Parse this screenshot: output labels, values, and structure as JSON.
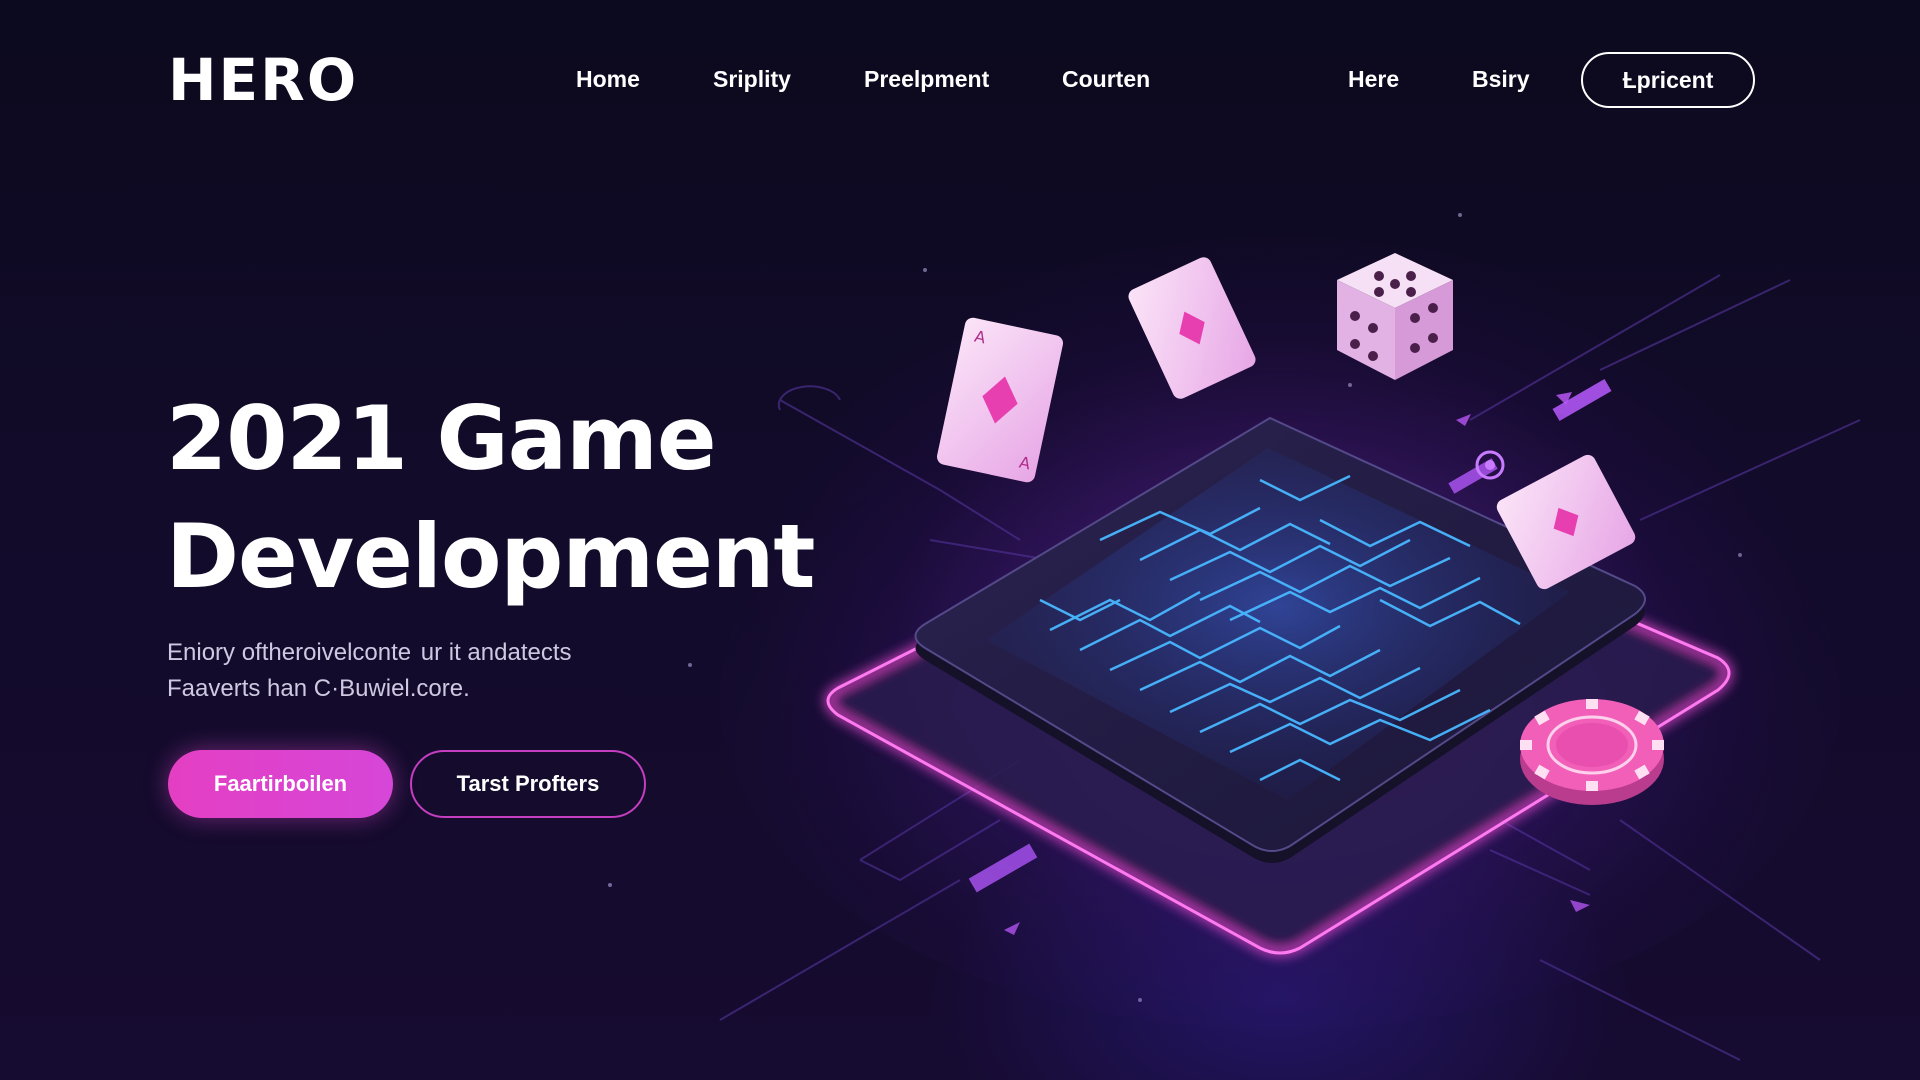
{
  "brand": {
    "logo": "HERO"
  },
  "nav": {
    "links": [
      "Home",
      "Sriplity",
      "Preelpment",
      "Courten",
      "Here",
      "Bsiry"
    ],
    "cta": "Ƚpricent"
  },
  "hero": {
    "title_line1": "2021 Game",
    "title_line2": "Development",
    "desc_line1": "Eniory oftheroivelconte  ur it andatects",
    "desc_line2": "Faaverts han C·Buwiel.core.",
    "primary_cta": "Faartirboilen",
    "secondary_cta": "Tarst Profters"
  },
  "colors": {
    "background": "#120b2a",
    "accent_pink": "#e43fc3",
    "accent_blue": "#3aa0ff",
    "card_face": "#f2c4ef"
  },
  "illustration": {
    "elements": [
      "card-icon",
      "dice-icon",
      "poker-chip-icon",
      "maze-tablet",
      "glow-platform"
    ]
  }
}
